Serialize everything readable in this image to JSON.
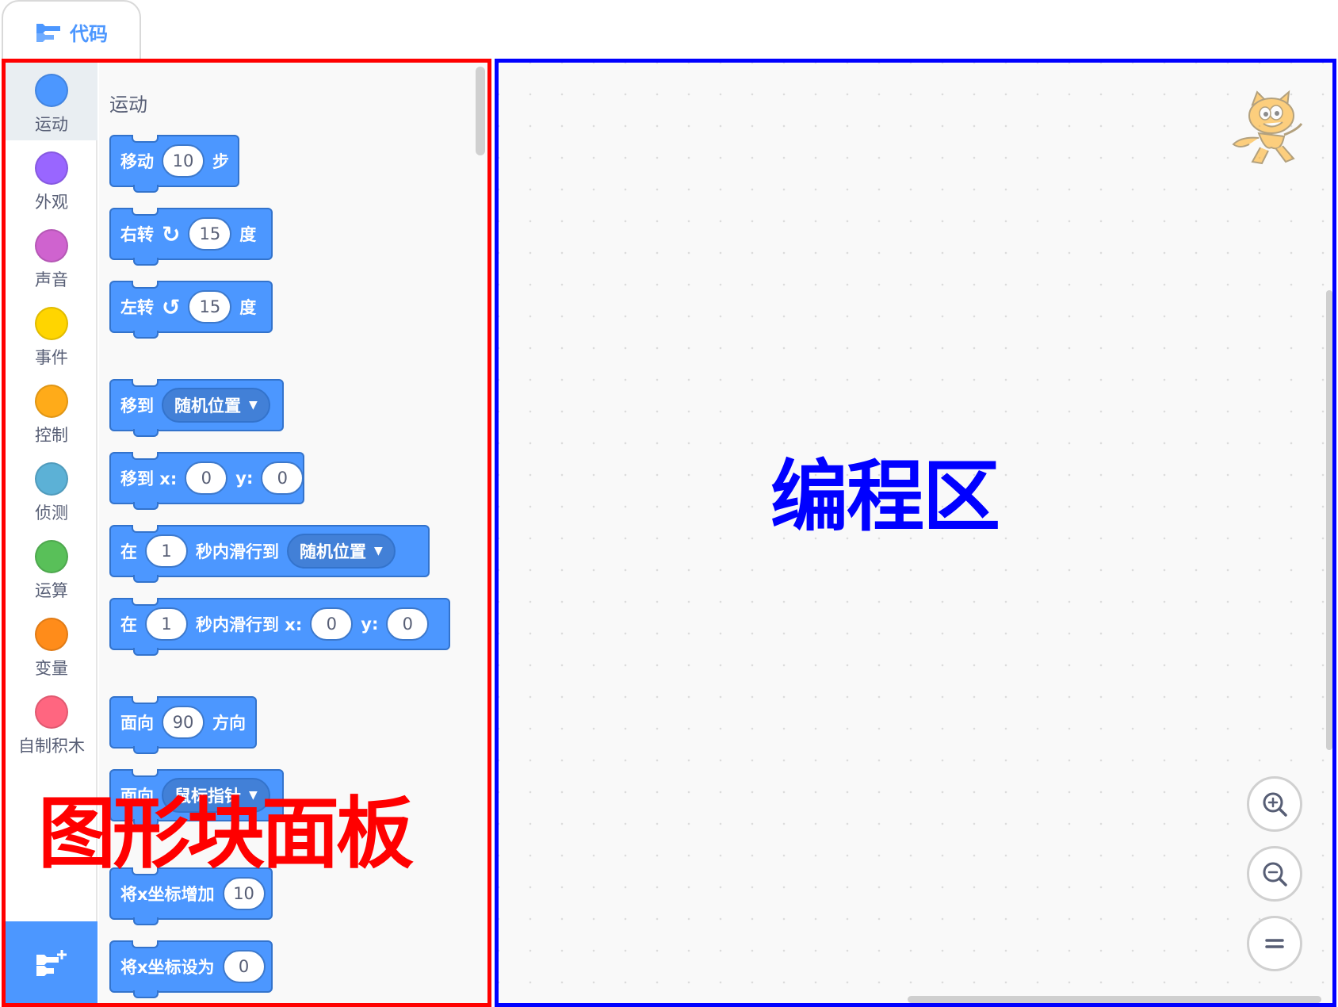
{
  "tab": {
    "label": "代码",
    "icon": "code-blocks-icon"
  },
  "categories": [
    {
      "label": "运动",
      "color": "#4c97ff",
      "selected": true
    },
    {
      "label": "外观",
      "color": "#9966ff",
      "selected": false
    },
    {
      "label": "声音",
      "color": "#cf63cf",
      "selected": false
    },
    {
      "label": "事件",
      "color": "#ffd500",
      "selected": false
    },
    {
      "label": "控制",
      "color": "#ffab19",
      "selected": false
    },
    {
      "label": "侦测",
      "color": "#5cb1d6",
      "selected": false
    },
    {
      "label": "运算",
      "color": "#59c059",
      "selected": false
    },
    {
      "label": "变量",
      "color": "#ff8c1a",
      "selected": false
    },
    {
      "label": "自制积木",
      "color": "#ff6680",
      "selected": false
    }
  ],
  "extension_button": {
    "icon": "add-extension-icon"
  },
  "flyout": {
    "title": "运动",
    "blocks": [
      {
        "t1": "移动",
        "v1": "10",
        "t2": "步"
      },
      {
        "t1": "右转",
        "arrow": "↻",
        "v1": "15",
        "t2": "度"
      },
      {
        "t1": "左转",
        "arrow": "↺",
        "v1": "15",
        "t2": "度"
      },
      {
        "t1": "移到",
        "d1": "随机位置"
      },
      {
        "t1": "移到 x:",
        "v1": "0",
        "t2": "y:",
        "v2": "0"
      },
      {
        "t1": "在",
        "v1": "1",
        "t2": "秒内滑行到",
        "d1": "随机位置"
      },
      {
        "t1": "在",
        "v1": "1",
        "t2": "秒内滑行到 x:",
        "v2": "0",
        "t3": "y:",
        "v3": "0"
      },
      {
        "t1": "面向",
        "v1": "90",
        "t2": "方向"
      },
      {
        "t1": "面向",
        "d1": "鼠标指针"
      },
      {
        "t1": "将x坐标增加",
        "v1": "10"
      },
      {
        "t1": "将x坐标设为",
        "v1": "0"
      }
    ]
  },
  "workspace": {
    "sprite_icon": "scratch-cat-sprite-icon"
  },
  "zoom": {
    "in_icon": "zoom-in-icon",
    "out_icon": "zoom-out-icon",
    "reset_icon": "zoom-reset-icon"
  },
  "annotations": {
    "palette_label": "图形块面板",
    "workspace_label": "编程区",
    "palette_color": "#ff0000",
    "workspace_color": "#0000ff"
  }
}
